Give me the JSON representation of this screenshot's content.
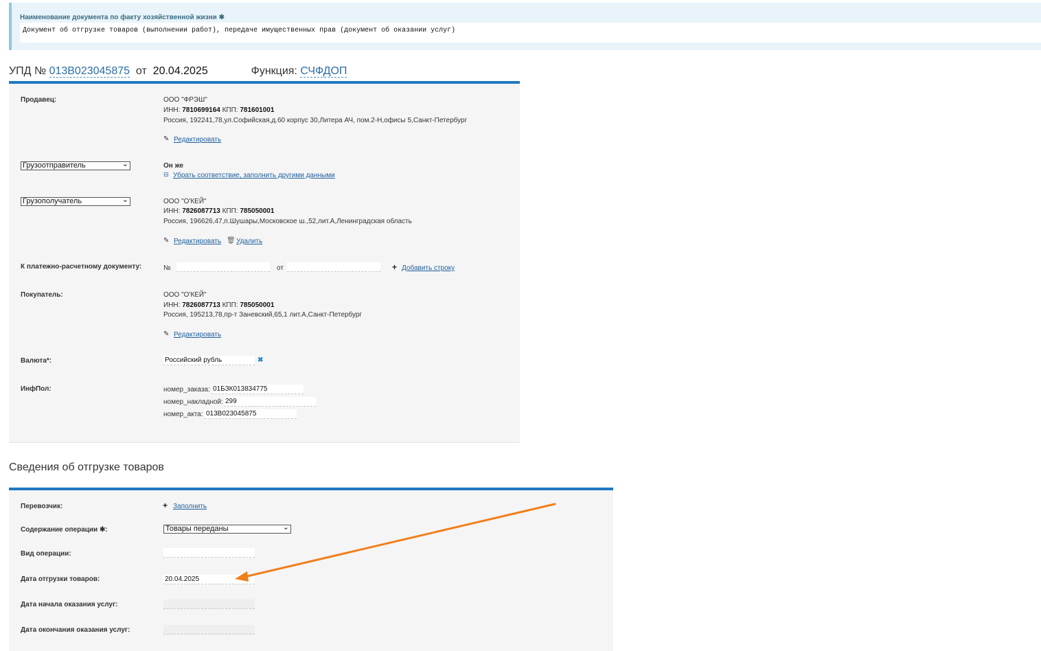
{
  "doc_name": {
    "label": "Наименование документа по факту хозяйственной жизни",
    "required_mark": "✱",
    "value": "Документ об отгрузке товаров (выполнении работ), передаче имущественных прав (документ об оказании услуг)"
  },
  "header": {
    "prefix": "УПД №",
    "number": "013В023045875",
    "from_word": "от",
    "date": "20.04.2025",
    "function_label": "Функция:",
    "function_value": "СЧФДОП"
  },
  "seller": {
    "label": "Продавец:",
    "name": "ООО \"ФРЭШ\"",
    "inn_label": "ИНН:",
    "inn": "7810699164",
    "kpp_label": "КПП:",
    "kpp": "781601001",
    "address": "Россия, 192241,78,ул.Софийская,д.60 корпус 30,Литера АЧ, пом.2-Н,офисы 5,Санкт-Петербург",
    "edit_label": "Редактировать"
  },
  "shipper": {
    "select_value": "Грузоотправитель",
    "same_text": "Он же",
    "remove_link": "Убрать соответствие, заполнить другими данными"
  },
  "consignee": {
    "select_value": "Грузополучатель",
    "name": "ООО \"О'КЕЙ\"",
    "inn_label": "ИНН:",
    "inn": "7826087713",
    "kpp_label": "КПП:",
    "kpp": "785050001",
    "address": "Россия, 196626,47,п.Шушары,Московское ш.,52,лит.А,Ленинградская область",
    "edit_label": "Редактировать",
    "delete_label": "Удалить"
  },
  "payment_doc": {
    "label": "К платежно-расчетному документу:",
    "number_sign": "№",
    "from_word": "от",
    "add_row": "Добавить строку"
  },
  "buyer": {
    "label": "Покупатель:",
    "name": "ООО \"О'КЕЙ\"",
    "inn_label": "ИНН:",
    "inn": "7826087713",
    "kpp_label": "КПП:",
    "kpp": "785050001",
    "address": "Россия, 195213,78,пр-т Заневский,65,1 лит.А,Санкт-Петербург",
    "edit_label": "Редактировать"
  },
  "currency": {
    "label": "Валюта*:",
    "value": "Российский рубль"
  },
  "infpol": {
    "label": "ИнфПол:",
    "order_label": "номер_заказа:",
    "order_value": "01БЗК013834775",
    "invoice_label": "номер_накладной:",
    "invoice_value": "299",
    "act_label": "номер_акта:",
    "act_value": "013В023045875"
  },
  "shipment": {
    "title": "Сведения об отгрузке товаров",
    "carrier_label": "Перевозчик:",
    "carrier_fill": "Заполнить",
    "operation_label": "Содержание операции",
    "operation_suffix": ":",
    "operation_value": "Товары переданы",
    "op_type_label": "Вид операции:",
    "op_type_value": "",
    "ship_date_label": "Дата отгрузки товаров:",
    "ship_date_value": "20.04.2025",
    "service_start_label": "Дата начала оказания услуг:",
    "service_end_label": "Дата окончания оказания услуг:"
  },
  "colors": {
    "accent": "#1f78c1",
    "link": "#1f5f9e",
    "arrow": "#f07f1a"
  }
}
